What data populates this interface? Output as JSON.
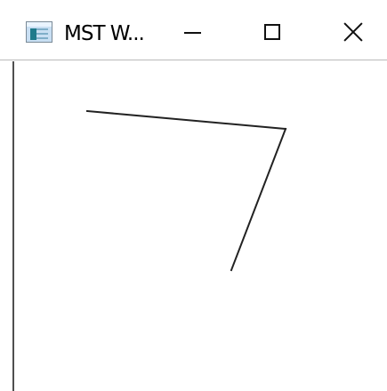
{
  "window": {
    "title": "MST W...",
    "controls": {
      "minimize": "minimize-icon",
      "maximize": "maximize-icon",
      "close": "close-icon"
    }
  },
  "canvas": {
    "background": "#ffffff",
    "line_color": "#222222"
  }
}
